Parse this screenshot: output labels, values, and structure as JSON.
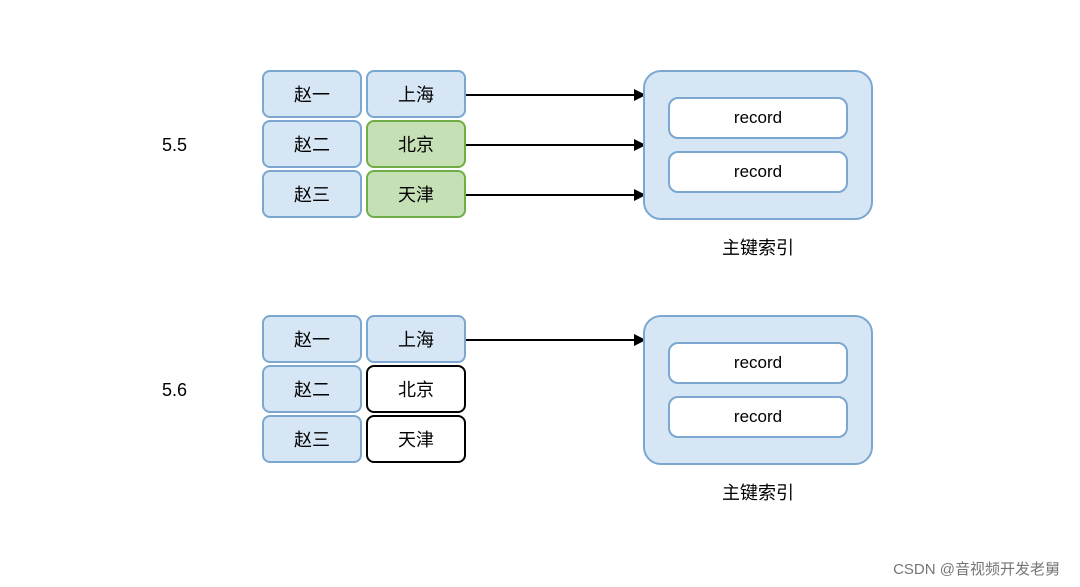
{
  "versions": {
    "v1": "5.5",
    "v2": "5.6"
  },
  "group1": {
    "col1": [
      "赵一",
      "赵二",
      "赵三"
    ],
    "col2": [
      "上海",
      "北京",
      "天津"
    ],
    "records": [
      "record",
      "record"
    ],
    "index_label": "主键索引"
  },
  "group2": {
    "col1": [
      "赵一",
      "赵二",
      "赵三"
    ],
    "col2": [
      "上海",
      "北京",
      "天津"
    ],
    "records": [
      "record",
      "record"
    ],
    "index_label": "主键索引"
  },
  "watermark": "CSDN @音视频开发老舅"
}
